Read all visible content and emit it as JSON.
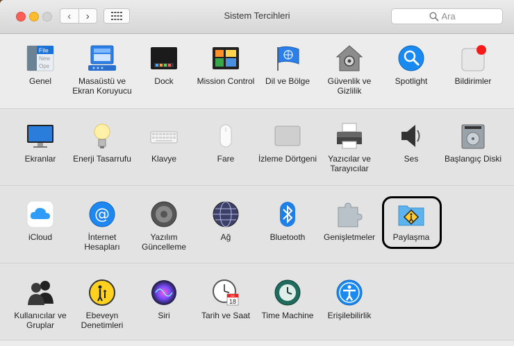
{
  "window": {
    "title": "Sistem Tercihleri"
  },
  "search": {
    "placeholder": "Ara"
  },
  "rows": [
    {
      "items": [
        {
          "name": "general",
          "label": "Genel"
        },
        {
          "name": "desktop-screensaver",
          "label": "Masaüstü ve Ekran Koruyucu"
        },
        {
          "name": "dock",
          "label": "Dock"
        },
        {
          "name": "mission-control",
          "label": "Mission Control"
        },
        {
          "name": "language-region",
          "label": "Dil ve Bölge"
        },
        {
          "name": "security-privacy",
          "label": "Güvenlik ve Gizlilik"
        },
        {
          "name": "spotlight",
          "label": "Spotlight"
        },
        {
          "name": "notifications",
          "label": "Bildirimler"
        }
      ]
    },
    {
      "items": [
        {
          "name": "displays",
          "label": "Ekranlar"
        },
        {
          "name": "energy-saver",
          "label": "Enerji Tasarrufu"
        },
        {
          "name": "keyboard",
          "label": "Klavye"
        },
        {
          "name": "mouse",
          "label": "Fare"
        },
        {
          "name": "trackpad",
          "label": "İzleme Dörtgeni"
        },
        {
          "name": "printers-scanners",
          "label": "Yazıcılar ve Tarayıcılar"
        },
        {
          "name": "sound",
          "label": "Ses"
        },
        {
          "name": "startup-disk",
          "label": "Başlangıç Diski"
        }
      ]
    },
    {
      "items": [
        {
          "name": "icloud",
          "label": "iCloud"
        },
        {
          "name": "internet-accounts",
          "label": "İnternet Hesapları"
        },
        {
          "name": "software-update",
          "label": "Yazılım Güncelleme"
        },
        {
          "name": "network",
          "label": "Ağ"
        },
        {
          "name": "bluetooth",
          "label": "Bluetooth"
        },
        {
          "name": "extensions",
          "label": "Genişletmeler"
        },
        {
          "name": "sharing",
          "label": "Paylaşma"
        }
      ]
    },
    {
      "items": [
        {
          "name": "users-groups",
          "label": "Kullanıcılar ve Gruplar"
        },
        {
          "name": "parental-controls",
          "label": "Ebeveyn Denetimleri"
        },
        {
          "name": "siri",
          "label": "Siri"
        },
        {
          "name": "date-time",
          "label": "Tarih ve Saat"
        },
        {
          "name": "time-machine",
          "label": "Time Machine"
        },
        {
          "name": "accessibility",
          "label": "Erişilebilirlik"
        }
      ]
    }
  ],
  "icons": {
    "general": "general-icon",
    "file_tile_text": "File",
    "file_tile_line2": "New",
    "file_tile_line3": "Ope",
    "date_time_month": "JUL",
    "date_time_day": "18"
  }
}
